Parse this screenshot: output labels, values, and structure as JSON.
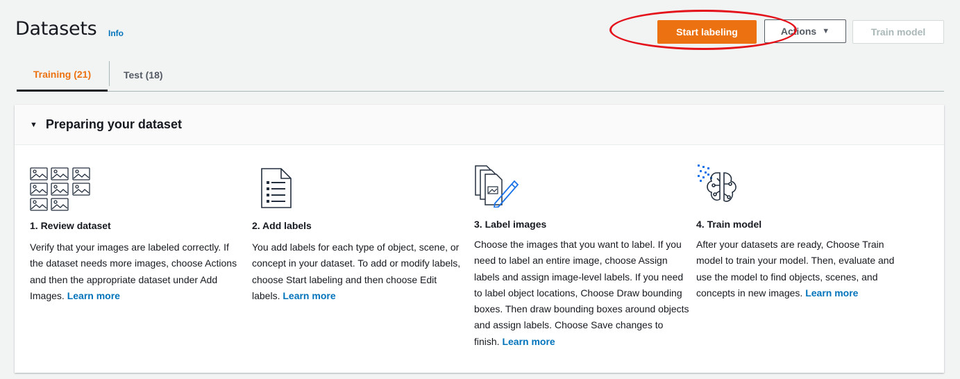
{
  "header": {
    "title": "Datasets",
    "info_label": "Info"
  },
  "actions": {
    "start_labeling": "Start labeling",
    "actions_label": "Actions",
    "train_model": "Train model"
  },
  "tabs": [
    {
      "label": "Training (21)",
      "selected": true
    },
    {
      "label": "Test (18)",
      "selected": false
    }
  ],
  "panel": {
    "title": "Preparing your dataset",
    "expanded": true,
    "steps": [
      {
        "icon": "image-grid-icon",
        "title": "1. Review dataset",
        "text": "Verify that your images are labeled correctly. If the dataset needs more images, choose Actions and then the appropriate dataset under Add Images.",
        "link": "Learn more"
      },
      {
        "icon": "document-list-icon",
        "title": "2. Add labels",
        "text": "You add labels for each type of object, scene, or concept in your dataset. To add or modify labels, choose Start labeling and then choose Edit labels.",
        "link": "Learn more"
      },
      {
        "icon": "label-pencil-icon",
        "title": "3. Label images",
        "text": "Choose the images that you want to label. If you need to label an entire image, choose Assign labels and assign image-level labels. If you need to label object locations, Choose Draw bounding boxes. Then draw bounding boxes around objects and assign labels. Choose Save changes to finish.",
        "link": "Learn more"
      },
      {
        "icon": "brain-network-icon",
        "title": "4. Train model",
        "text": "After your datasets are ready, Choose Train model to train your model. Then, evaluate and use the model to find objects, scenes, and concepts in new images.",
        "link": "Learn more"
      }
    ]
  },
  "colors": {
    "accent": "#ec7211",
    "link": "#0073bb",
    "annotation": "#e3121b"
  }
}
